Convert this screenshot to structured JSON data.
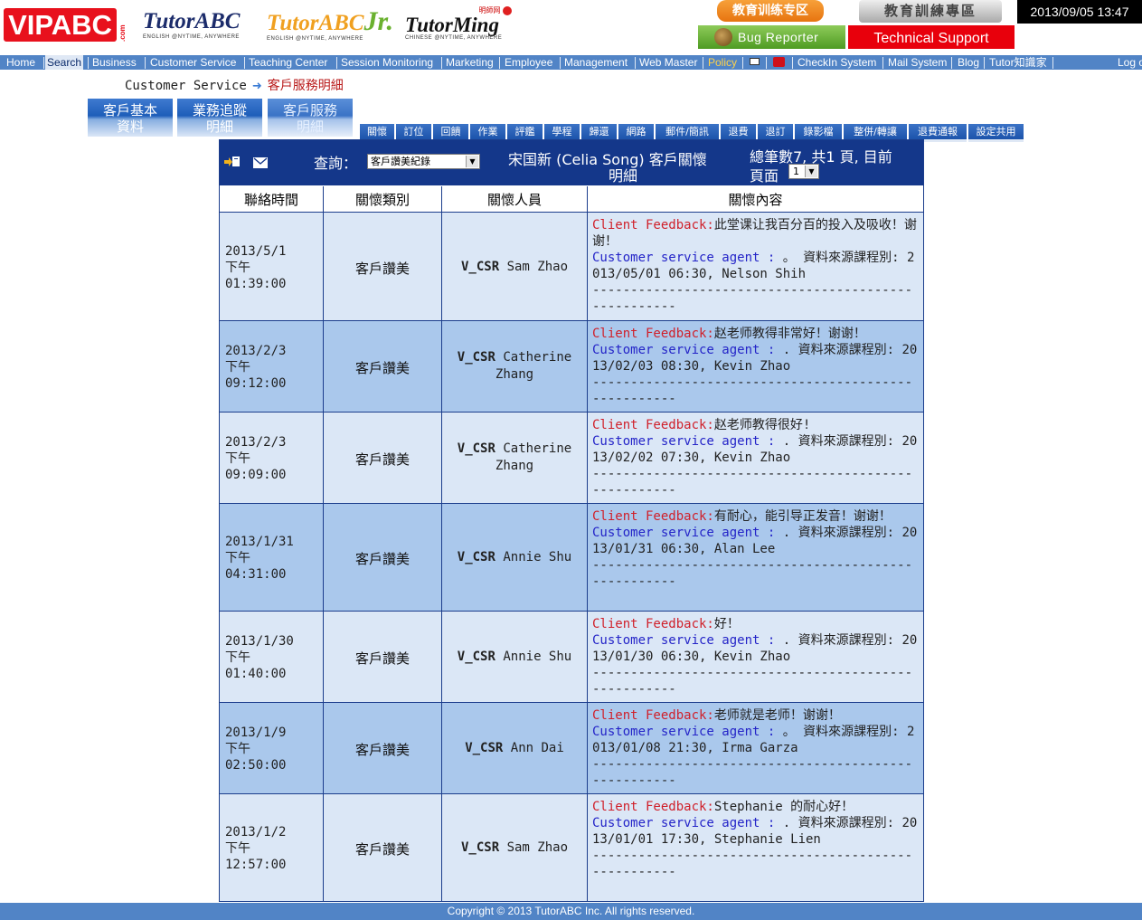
{
  "header": {
    "logos": {
      "vipabc": "VIPABC",
      "vipabc_com": ".com",
      "tutorabc": "TutorABC",
      "tutorabc_tagline": "ENGLISH @NYTIME, ANYWHERE",
      "tutorabc_jr": "TutorABC",
      "tutorabc_jr_suffix": "Jr.",
      "tutorabc_jr_tagline": "ENGLISH @NYTIME, ANYWHERE",
      "tutorming_top": "明師网",
      "tutorming": "TutorMing",
      "tutorming_tagline": "CHINESE @NYTIME, ANYWHERE"
    },
    "edu_zone_button": "教育训练专区",
    "edu_training_button": "教育訓練專區",
    "datetime": "2013/09/05 13:47",
    "bug_reporter_button": "Bug Reporter",
    "tech_support_button": "Technical Support"
  },
  "nav": {
    "items": [
      "Home",
      "Search",
      "Business",
      "Customer Service",
      "Teaching Center",
      "Session Monitoring",
      "Marketing",
      "Employee",
      "Management",
      "Web Master",
      "Policy",
      "CheckIn System",
      "Mail System",
      "Blog",
      "Tutor知識家",
      "Log o"
    ],
    "active": "Search",
    "highlight_color": "#ffd24a"
  },
  "breadcrumb": {
    "root": "Customer Service",
    "current": "客戶服務明細"
  },
  "big_tabs": [
    {
      "line1": "客戶基本",
      "line2": "資料"
    },
    {
      "line1": "業務追蹤",
      "line2": "明細"
    },
    {
      "line1": "客戶服務",
      "line2": "明細"
    }
  ],
  "sub_tabs": [
    "關懷",
    "訂位",
    "回饋",
    "作業",
    "評鑑",
    "學程",
    "歸還",
    "網路",
    "郵件/簡訊",
    "退費",
    "退訂",
    "錄影檔",
    "整併/轉讓",
    "退費通報",
    "設定共用"
  ],
  "panel": {
    "query_label": "查詢：",
    "query_value": "客戶讚美紀錄",
    "student_line1": "宋国新 (Celia Song) 客戶關懷",
    "student_line2": "明細",
    "total_line1": "總筆數7, 共1 頁, 目前",
    "total_line2": "頁面",
    "page_value": "1"
  },
  "table": {
    "headers": [
      "聯絡時間",
      "關懷類別",
      "關懷人員",
      "關懷內容"
    ],
    "rows": [
      {
        "date": "2013/5/1",
        "ampm": "下午",
        "time": "01:39:00",
        "type": "客戶讚美",
        "staff_prefix": "V_CSR",
        "staff_name": "Sam Zhao",
        "feedback_label": "Client Feedback:",
        "feedback": "此堂课让我百分百的投入及吸收！谢谢！",
        "agent_label": "Customer service agent :",
        "agent_suffix": " 。 資料來源課程別: 2013/05/01 06:30, Nelson Shih",
        "dashes": "-----------------------------------------------------"
      },
      {
        "date": "2013/2/3",
        "ampm": "下午",
        "time": "09:12:00",
        "type": "客戶讚美",
        "staff_prefix": "V_CSR",
        "staff_name": "Catherine Zhang",
        "feedback_label": "Client Feedback:",
        "feedback": "赵老师教得非常好！谢谢！",
        "agent_label": "Customer service agent :",
        "agent_suffix": " . 資料來源課程別: 2013/02/03 08:30, Kevin Zhao",
        "dashes": "-----------------------------------------------------"
      },
      {
        "date": "2013/2/3",
        "ampm": "下午",
        "time": "09:09:00",
        "type": "客戶讚美",
        "staff_prefix": "V_CSR",
        "staff_name": "Catherine Zhang",
        "feedback_label": "Client Feedback:",
        "feedback": "赵老师教得很好!",
        "agent_label": "Customer service agent :",
        "agent_suffix": " . 資料來源課程別: 2013/02/02 07:30, Kevin Zhao",
        "dashes": "-----------------------------------------------------"
      },
      {
        "date": "2013/1/31",
        "ampm": "下午",
        "time": "04:31:00",
        "type": "客戶讚美",
        "staff_prefix": "V_CSR",
        "staff_name": "Annie Shu",
        "feedback_label": "Client Feedback:",
        "feedback": "有耐心，能引导正发音！谢谢！",
        "agent_label": "Customer service agent :",
        "agent_suffix": " . 資料來源課程別: 2013/01/31 06:30, Alan Lee",
        "dashes": "-----------------------------------------------------"
      },
      {
        "date": "2013/1/30",
        "ampm": "下午",
        "time": "01:40:00",
        "type": "客戶讚美",
        "staff_prefix": "V_CSR",
        "staff_name": "Annie Shu",
        "feedback_label": "Client Feedback:",
        "feedback": "好！",
        "agent_label": "Customer service agent :",
        "agent_suffix": " . 資料來源課程別: 2013/01/30 06:30, Kevin Zhao",
        "dashes": "-----------------------------------------------------"
      },
      {
        "date": "2013/1/9",
        "ampm": "下午",
        "time": "02:50:00",
        "type": "客戶讚美",
        "staff_prefix": "V_CSR",
        "staff_name": "Ann Dai",
        "feedback_label": "Client Feedback:",
        "feedback": "老师就是老师！谢谢！",
        "agent_label": "Customer service agent :",
        "agent_suffix": " 。 資料來源課程別: 2013/01/08 21:30, Irma Garza",
        "dashes": "-----------------------------------------------------"
      },
      {
        "date": "2013/1/2",
        "ampm": "下午",
        "time": "12:57:00",
        "type": "客戶讚美",
        "staff_prefix": "V_CSR",
        "staff_name": "Sam Zhao",
        "feedback_label": "Client Feedback:",
        "feedback": "Stephanie 的耐心好！",
        "agent_label": "Customer service agent :",
        "agent_suffix": " . 資料來源課程別: 2013/01/01 17:30, Stephanie Lien",
        "dashes": "-----------------------------------------------------"
      }
    ]
  },
  "footer": {
    "copyright": "Copyright © 2013 TutorABC Inc. All rights reserved."
  }
}
